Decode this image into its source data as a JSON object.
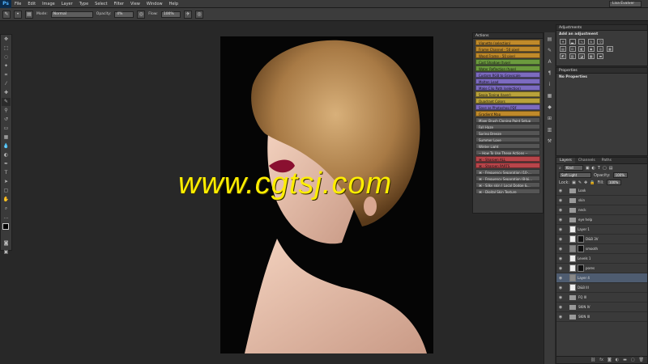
{
  "menubar": {
    "logo": "Ps",
    "items": [
      "File",
      "Edit",
      "Image",
      "Layer",
      "Type",
      "Select",
      "Filter",
      "View",
      "Window",
      "Help"
    ],
    "user": "Lisa Evalver"
  },
  "options": {
    "mode_label": "Mode:",
    "mode_value": "Normal",
    "opacity_label": "Opacity:",
    "opacity_value": "4%",
    "flow_label": "Flow:",
    "flow_value": "100%"
  },
  "watermark": "www.cgtsj.com",
  "actions": {
    "title": "Actions",
    "items": [
      {
        "label": "Vignette (selection)",
        "color": "#c08a2a"
      },
      {
        "label": "Frame Channel - 50 pixel",
        "color": "#c08a2a"
      },
      {
        "label": "Wood Frame - 50 pixel",
        "color": "#c08a2a"
      },
      {
        "label": "Cast Shadow (type)",
        "color": "#6b9a3e"
      },
      {
        "label": "Water Reflection (type)",
        "color": "#6b9a3e"
      },
      {
        "label": "Custom RGB to Grayscale",
        "color": "#7c6bc0"
      },
      {
        "label": "Molten Lead",
        "color": "#7c6bc0"
      },
      {
        "label": "Make Clip Path (selection)",
        "color": "#7c6bc0"
      },
      {
        "label": "Sepia Toning (layer)",
        "color": "#b9a23a"
      },
      {
        "label": "Quadrant Colors",
        "color": "#b9a23a"
      },
      {
        "label": "Save as Photoshop PDF",
        "color": "#7c6bc0"
      },
      {
        "label": "Gradient Map",
        "color": "#c08a2a"
      },
      {
        "label": "Mixer Brush Cloning Paint Setup",
        "color": "#555555"
      },
      {
        "label": "Fall Haze",
        "color": "#555555"
      },
      {
        "label": "Spring Breeze",
        "color": "#555555"
      },
      {
        "label": "Summer Love",
        "color": "#555555"
      },
      {
        "label": "Winter Light",
        "color": "#555555"
      },
      {
        "label": "-- How To Use These Actions --",
        "color": "#555555"
      },
      {
        "label": "⌘ - Sharpen ALL",
        "color": "#b8454a"
      },
      {
        "label": "⌘ - Sharpen PARTS",
        "color": "#b8454a"
      },
      {
        "label": "⌘ - Frequency Separation (10-...",
        "color": "#555555"
      },
      {
        "label": "⌘ - Frequency Separation (8-bi...",
        "color": "#555555"
      },
      {
        "label": "⌘ - Silky skin ( Local Dodge &...",
        "color": "#555555"
      },
      {
        "label": "⌘ - Digital Skin Texture",
        "color": "#555555"
      }
    ]
  },
  "adjustments": {
    "title": "Adjustments",
    "subtitle": "Add an adjustment"
  },
  "properties": {
    "title": "Properties",
    "text": "No Properties"
  },
  "layers": {
    "tabs": [
      "Layers",
      "Channels",
      "Paths"
    ],
    "kind_label": "Kind",
    "blend_mode": "Soft Light",
    "opacity_label": "Opacity:",
    "opacity_value": "100%",
    "lock_label": "Lock:",
    "fill_label": "Fill:",
    "fill_value": "100%",
    "rows": [
      {
        "name": "Look",
        "type": "folder",
        "sel": false
      },
      {
        "name": "skin",
        "type": "folder",
        "sel": false
      },
      {
        "name": "neck",
        "type": "folder",
        "sel": false
      },
      {
        "name": "eye help",
        "type": "folder",
        "sel": false
      },
      {
        "name": "Layer 1",
        "type": "layer",
        "sel": false
      },
      {
        "name": "D&B 3V",
        "type": "layer",
        "sel": false
      },
      {
        "name": "smooth",
        "type": "layer",
        "sel": false
      },
      {
        "name": "Levels 1",
        "type": "layer",
        "sel": false
      },
      {
        "name": "pores",
        "type": "layer",
        "sel": false
      },
      {
        "name": "Layer 4",
        "type": "layer",
        "sel": true
      },
      {
        "name": "D&B III",
        "type": "layer",
        "sel": false
      },
      {
        "name": "FQ III",
        "type": "folder",
        "sel": false
      },
      {
        "name": "SKIN IV",
        "type": "folder",
        "sel": false
      },
      {
        "name": "SKIN III",
        "type": "folder",
        "sel": false
      }
    ]
  }
}
